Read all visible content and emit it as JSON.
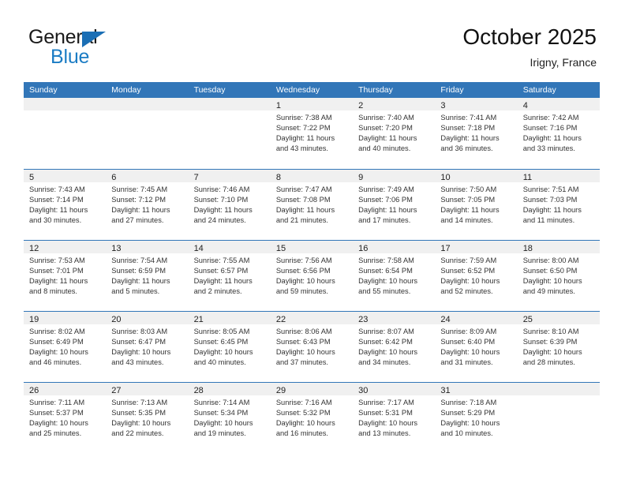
{
  "brand": {
    "line1": "General",
    "line2": "Blue",
    "mark": "triangle-logo"
  },
  "header": {
    "title": "October 2025",
    "subtitle": "Irigny, France"
  },
  "weekdays": [
    "Sunday",
    "Monday",
    "Tuesday",
    "Wednesday",
    "Thursday",
    "Friday",
    "Saturday"
  ],
  "colors": {
    "header_blue": "#3276b8",
    "day_band_gray": "#f0f0f0",
    "brand_blue": "#1b7cc4",
    "text": "#333333"
  },
  "weeks": [
    [
      {
        "day": "",
        "lines": []
      },
      {
        "day": "",
        "lines": []
      },
      {
        "day": "",
        "lines": []
      },
      {
        "day": "1",
        "lines": [
          "Sunrise: 7:38 AM",
          "Sunset: 7:22 PM",
          "Daylight: 11 hours",
          "and 43 minutes."
        ]
      },
      {
        "day": "2",
        "lines": [
          "Sunrise: 7:40 AM",
          "Sunset: 7:20 PM",
          "Daylight: 11 hours",
          "and 40 minutes."
        ]
      },
      {
        "day": "3",
        "lines": [
          "Sunrise: 7:41 AM",
          "Sunset: 7:18 PM",
          "Daylight: 11 hours",
          "and 36 minutes."
        ]
      },
      {
        "day": "4",
        "lines": [
          "Sunrise: 7:42 AM",
          "Sunset: 7:16 PM",
          "Daylight: 11 hours",
          "and 33 minutes."
        ]
      }
    ],
    [
      {
        "day": "5",
        "lines": [
          "Sunrise: 7:43 AM",
          "Sunset: 7:14 PM",
          "Daylight: 11 hours",
          "and 30 minutes."
        ]
      },
      {
        "day": "6",
        "lines": [
          "Sunrise: 7:45 AM",
          "Sunset: 7:12 PM",
          "Daylight: 11 hours",
          "and 27 minutes."
        ]
      },
      {
        "day": "7",
        "lines": [
          "Sunrise: 7:46 AM",
          "Sunset: 7:10 PM",
          "Daylight: 11 hours",
          "and 24 minutes."
        ]
      },
      {
        "day": "8",
        "lines": [
          "Sunrise: 7:47 AM",
          "Sunset: 7:08 PM",
          "Daylight: 11 hours",
          "and 21 minutes."
        ]
      },
      {
        "day": "9",
        "lines": [
          "Sunrise: 7:49 AM",
          "Sunset: 7:06 PM",
          "Daylight: 11 hours",
          "and 17 minutes."
        ]
      },
      {
        "day": "10",
        "lines": [
          "Sunrise: 7:50 AM",
          "Sunset: 7:05 PM",
          "Daylight: 11 hours",
          "and 14 minutes."
        ]
      },
      {
        "day": "11",
        "lines": [
          "Sunrise: 7:51 AM",
          "Sunset: 7:03 PM",
          "Daylight: 11 hours",
          "and 11 minutes."
        ]
      }
    ],
    [
      {
        "day": "12",
        "lines": [
          "Sunrise: 7:53 AM",
          "Sunset: 7:01 PM",
          "Daylight: 11 hours",
          "and 8 minutes."
        ]
      },
      {
        "day": "13",
        "lines": [
          "Sunrise: 7:54 AM",
          "Sunset: 6:59 PM",
          "Daylight: 11 hours",
          "and 5 minutes."
        ]
      },
      {
        "day": "14",
        "lines": [
          "Sunrise: 7:55 AM",
          "Sunset: 6:57 PM",
          "Daylight: 11 hours",
          "and 2 minutes."
        ]
      },
      {
        "day": "15",
        "lines": [
          "Sunrise: 7:56 AM",
          "Sunset: 6:56 PM",
          "Daylight: 10 hours",
          "and 59 minutes."
        ]
      },
      {
        "day": "16",
        "lines": [
          "Sunrise: 7:58 AM",
          "Sunset: 6:54 PM",
          "Daylight: 10 hours",
          "and 55 minutes."
        ]
      },
      {
        "day": "17",
        "lines": [
          "Sunrise: 7:59 AM",
          "Sunset: 6:52 PM",
          "Daylight: 10 hours",
          "and 52 minutes."
        ]
      },
      {
        "day": "18",
        "lines": [
          "Sunrise: 8:00 AM",
          "Sunset: 6:50 PM",
          "Daylight: 10 hours",
          "and 49 minutes."
        ]
      }
    ],
    [
      {
        "day": "19",
        "lines": [
          "Sunrise: 8:02 AM",
          "Sunset: 6:49 PM",
          "Daylight: 10 hours",
          "and 46 minutes."
        ]
      },
      {
        "day": "20",
        "lines": [
          "Sunrise: 8:03 AM",
          "Sunset: 6:47 PM",
          "Daylight: 10 hours",
          "and 43 minutes."
        ]
      },
      {
        "day": "21",
        "lines": [
          "Sunrise: 8:05 AM",
          "Sunset: 6:45 PM",
          "Daylight: 10 hours",
          "and 40 minutes."
        ]
      },
      {
        "day": "22",
        "lines": [
          "Sunrise: 8:06 AM",
          "Sunset: 6:43 PM",
          "Daylight: 10 hours",
          "and 37 minutes."
        ]
      },
      {
        "day": "23",
        "lines": [
          "Sunrise: 8:07 AM",
          "Sunset: 6:42 PM",
          "Daylight: 10 hours",
          "and 34 minutes."
        ]
      },
      {
        "day": "24",
        "lines": [
          "Sunrise: 8:09 AM",
          "Sunset: 6:40 PM",
          "Daylight: 10 hours",
          "and 31 minutes."
        ]
      },
      {
        "day": "25",
        "lines": [
          "Sunrise: 8:10 AM",
          "Sunset: 6:39 PM",
          "Daylight: 10 hours",
          "and 28 minutes."
        ]
      }
    ],
    [
      {
        "day": "26",
        "lines": [
          "Sunrise: 7:11 AM",
          "Sunset: 5:37 PM",
          "Daylight: 10 hours",
          "and 25 minutes."
        ]
      },
      {
        "day": "27",
        "lines": [
          "Sunrise: 7:13 AM",
          "Sunset: 5:35 PM",
          "Daylight: 10 hours",
          "and 22 minutes."
        ]
      },
      {
        "day": "28",
        "lines": [
          "Sunrise: 7:14 AM",
          "Sunset: 5:34 PM",
          "Daylight: 10 hours",
          "and 19 minutes."
        ]
      },
      {
        "day": "29",
        "lines": [
          "Sunrise: 7:16 AM",
          "Sunset: 5:32 PM",
          "Daylight: 10 hours",
          "and 16 minutes."
        ]
      },
      {
        "day": "30",
        "lines": [
          "Sunrise: 7:17 AM",
          "Sunset: 5:31 PM",
          "Daylight: 10 hours",
          "and 13 minutes."
        ]
      },
      {
        "day": "31",
        "lines": [
          "Sunrise: 7:18 AM",
          "Sunset: 5:29 PM",
          "Daylight: 10 hours",
          "and 10 minutes."
        ]
      },
      {
        "day": "",
        "lines": []
      }
    ]
  ]
}
